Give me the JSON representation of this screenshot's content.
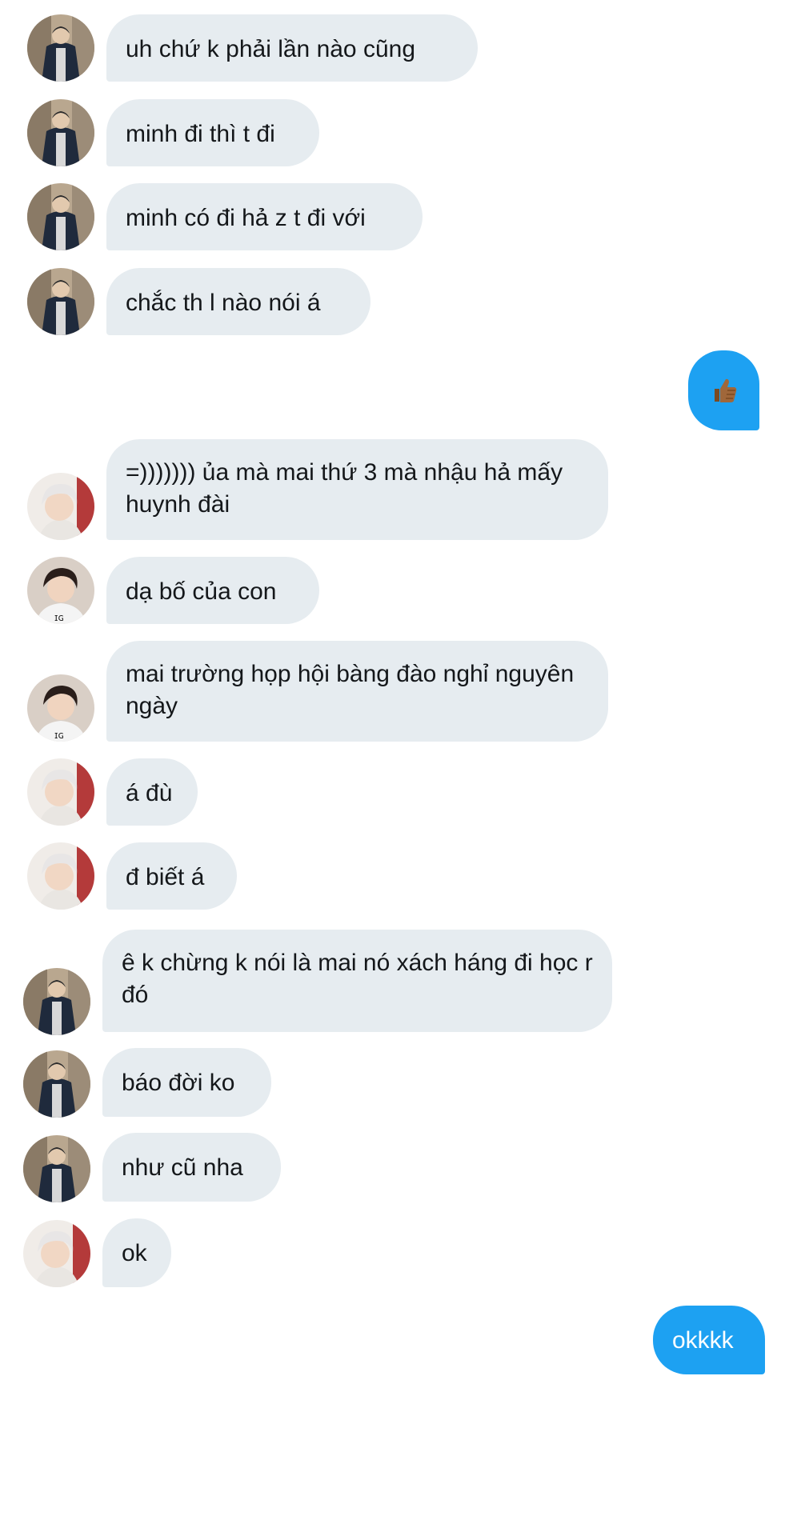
{
  "conversation": {
    "messages": [
      {
        "sender": "dark-jacket",
        "text": "uh chứ k phải lần nào cũng"
      },
      {
        "sender": "dark-jacket",
        "text": "minh đi thì t đi"
      },
      {
        "sender": "dark-jacket",
        "text": "minh có đi hả z t đi với"
      },
      {
        "sender": "dark-jacket",
        "text": "chắc th l nào nói á"
      },
      {
        "sender": "me",
        "text": "",
        "icon": "thumbs-up-icon"
      },
      {
        "sender": "silver-hair",
        "text": "=))))))) ủa mà mai thứ 3 mà nhậu hả mấy huynh đài"
      },
      {
        "sender": "dark-hair",
        "text": "dạ bố của con"
      },
      {
        "sender": "dark-hair",
        "text": "mai trường họp hội bàng đào nghỉ nguyên ngày"
      },
      {
        "sender": "silver-hair",
        "text": "á đù"
      },
      {
        "sender": "silver-hair",
        "text": "đ biết á"
      },
      {
        "sender": "dark-jacket",
        "text": "ê k chừng k nói là mai nó xách háng đi học r đó"
      },
      {
        "sender": "dark-jacket",
        "text": "báo đời ko"
      },
      {
        "sender": "dark-jacket",
        "text": "như cũ nha"
      },
      {
        "sender": "silver-hair",
        "text": "ok"
      },
      {
        "sender": "me",
        "text": "okkkk"
      }
    ]
  },
  "colors": {
    "received_bubble": "#e6ecf0",
    "sent_bubble": "#1da1f2",
    "received_text": "#14171a",
    "sent_text": "#ffffff"
  }
}
